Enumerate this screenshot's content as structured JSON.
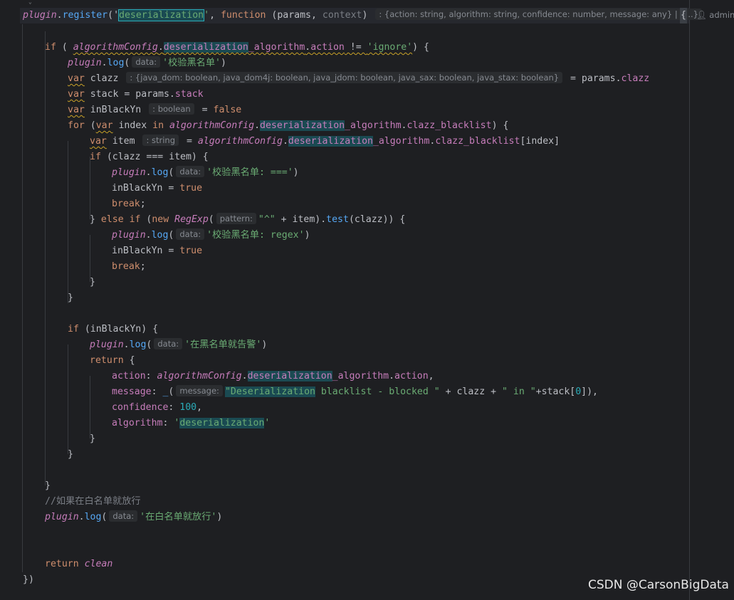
{
  "editor": {
    "language": "javascript",
    "author_hint": "admin@",
    "watermark": "CSDN @CarsonBigData"
  },
  "hints": {
    "register_return": ": {action: string, algorithm: string, confidence: number, message: any} | {...}",
    "data": "data:",
    "clazz_type": ": {java_dom: boolean, java_dom4j: boolean, java_jdom: boolean, java_sax: boolean, java_stax: boolean}",
    "boolean": ": boolean",
    "string": ": string",
    "pattern": "pattern:",
    "message": "message:"
  },
  "strings": {
    "deserialization": "deserialization",
    "ignore": "ignore",
    "log1": "'校验黑名单'",
    "log2": "'校验黑名单: ==='",
    "log3": "'校验黑名单: regex'",
    "log4": "'在黑名单就告警'",
    "regex_caret": "\"^\"",
    "msg_part1": "\"Deserialization",
    "msg_part2": " blacklist - blocked \"",
    "msg_in": "\" in \"",
    "comment_whitelist": "//如果在白名单就放行",
    "log5": "'在白名单就放行'"
  },
  "numbers": {
    "confidence": "100",
    "stack_index": "0"
  }
}
